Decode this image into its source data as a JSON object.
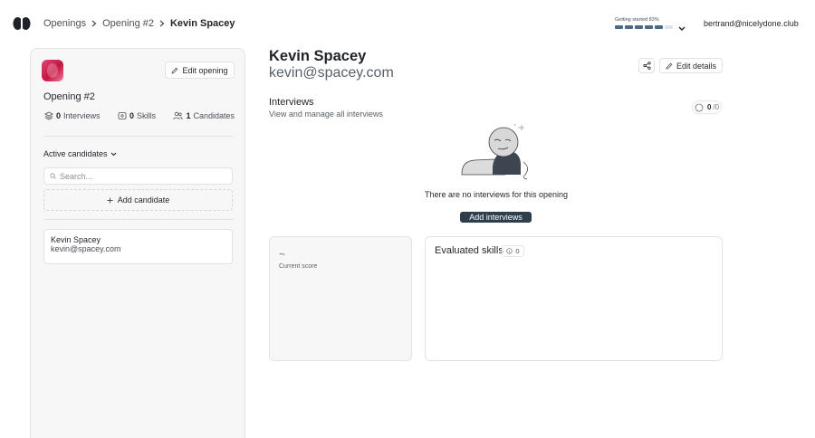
{
  "header": {
    "breadcrumbs": [
      "Openings",
      "Opening #2",
      "Kevin Spacey"
    ],
    "getting_started": "Getting started 83%",
    "progress_fraction": 0.83,
    "user_email": "bertrand@nicelydone.club"
  },
  "sidebar": {
    "edit_opening_label": "Edit opening",
    "opening_title": "Opening #2",
    "stats": {
      "interviews_count": "0",
      "interviews_label": "Interviews",
      "skills_count": "0",
      "skills_label": "Skills",
      "candidates_count": "1",
      "candidates_label": "Candidates"
    },
    "active_candidates_label": "Active candidates",
    "search_placeholder": "Search...",
    "add_candidate_label": "Add candidate",
    "candidates": [
      {
        "name": "Kevin Spacey",
        "email": "kevin@spacey.com"
      }
    ]
  },
  "candidate": {
    "name": "Kevin Spacey",
    "email": "kevin@spacey.com",
    "edit_details_label": "Edit details"
  },
  "interviews": {
    "title": "Interviews",
    "subtitle": "View and manage all interviews",
    "count_done": "0",
    "count_total": "/0",
    "empty_text": "There are no interviews for this opening",
    "add_button_label": "Add interviews"
  },
  "score": {
    "value": "~",
    "label": "Current score"
  },
  "skills": {
    "title": "Evaluated skills",
    "count": "0"
  },
  "colors": {
    "progress_on": "#4d6a80",
    "progress_off": "#dfe3e7",
    "primary_button": "#2f3e4b",
    "avatar": "#d42a5a"
  }
}
